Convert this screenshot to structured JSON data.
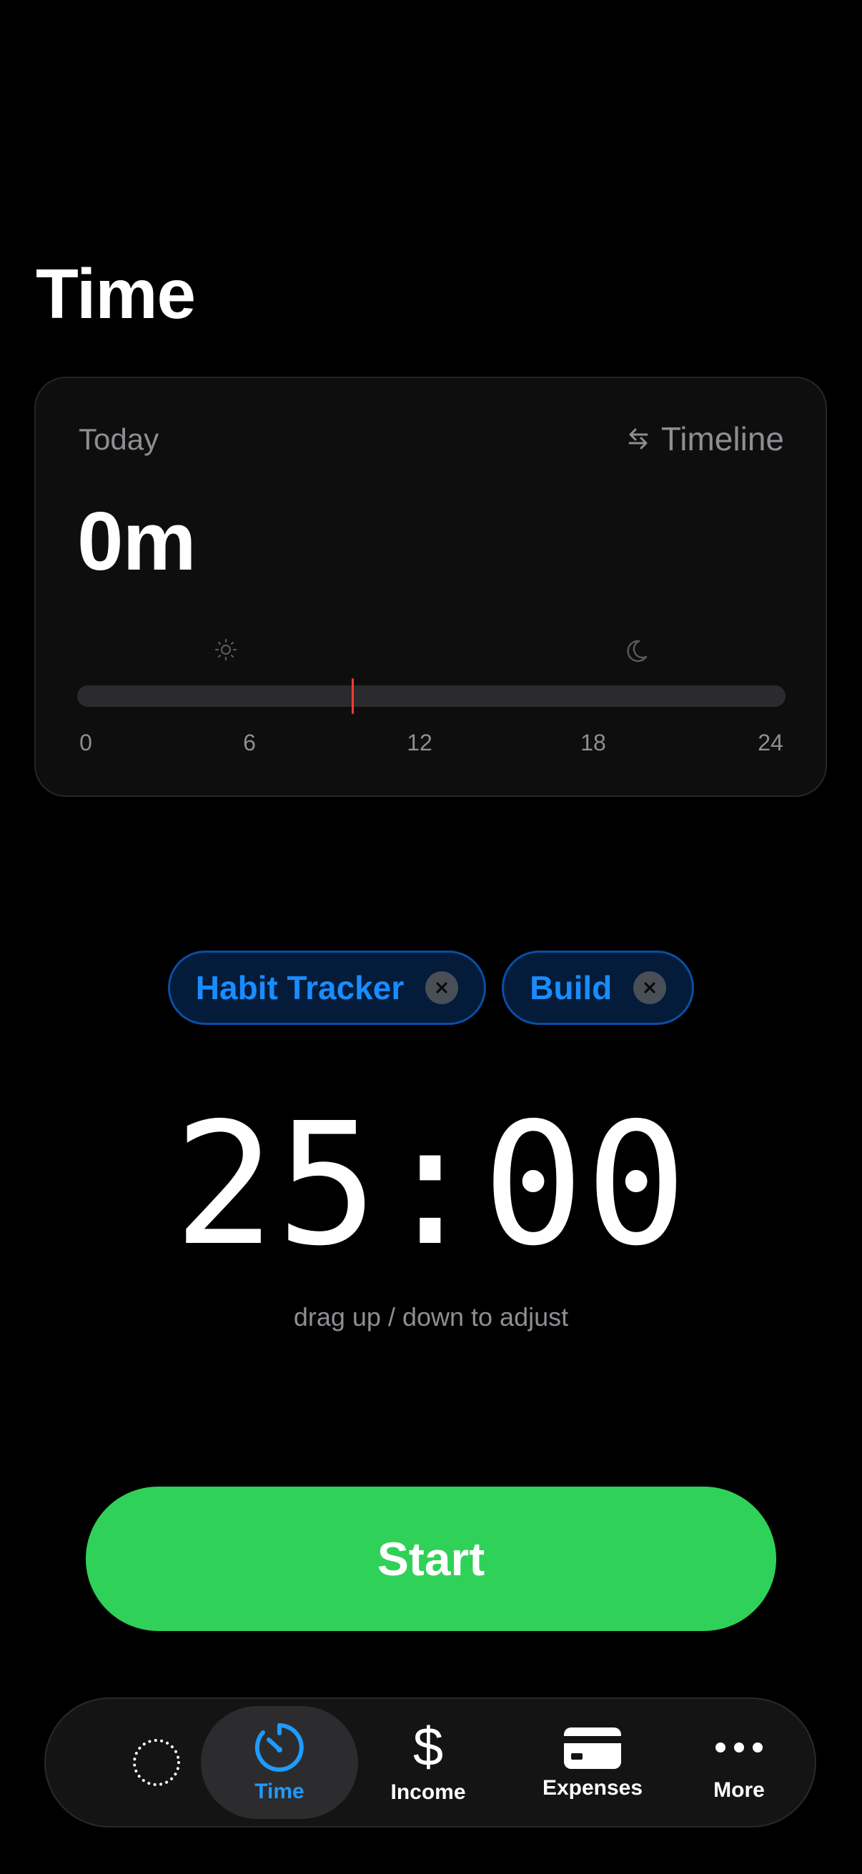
{
  "header": {
    "title": "Time"
  },
  "today_card": {
    "label": "Today",
    "timeline_label": "Timeline",
    "total": "0m",
    "axis_ticks": [
      "0",
      "6",
      "12",
      "18",
      "24"
    ],
    "current_hour": 9.3,
    "marker_color": "#ff3b30"
  },
  "chips": [
    {
      "label": "Habit Tracker"
    },
    {
      "label": "Build"
    }
  ],
  "timer": {
    "value": "25:00",
    "hint": "drag up / down to adjust"
  },
  "start_button": {
    "label": "Start",
    "color": "#30d158"
  },
  "tab_bar": {
    "active_color": "#1f9bff",
    "tabs": [
      {
        "label": "",
        "icon": "dotted-circle-icon"
      },
      {
        "label": "Time",
        "icon": "timer-icon",
        "active": true
      },
      {
        "label": "Income",
        "icon": "dollar-icon"
      },
      {
        "label": "Expenses",
        "icon": "credit-card-icon"
      },
      {
        "label": "More",
        "icon": "ellipsis-icon"
      }
    ]
  }
}
